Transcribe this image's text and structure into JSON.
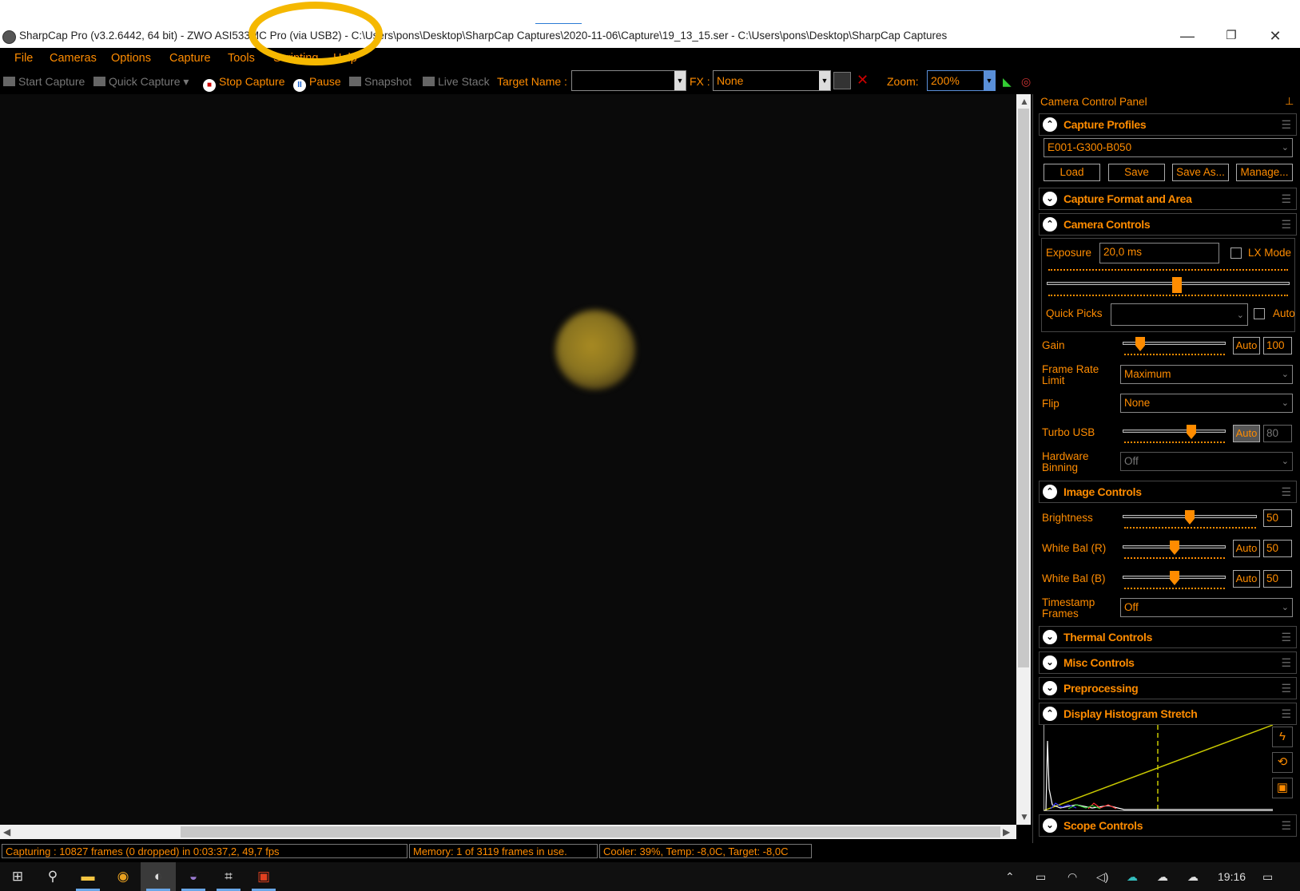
{
  "window": {
    "title": "SharpCap Pro (v3.2.6442, 64 bit) - ZWO ASI533MC Pro (via USB2) - C:\\Users\\pons\\Desktop\\SharpCap Captures\\2020-11-06\\Capture\\19_13_15.ser - C:\\Users\\pons\\Desktop\\SharpCap Captures",
    "minimize": "—",
    "maximize": "❐",
    "close": "✕"
  },
  "menu": [
    "File",
    "Cameras",
    "Options",
    "Capture",
    "Tools",
    "Scripting",
    "Help"
  ],
  "toolbar": {
    "start_capture": "Start Capture",
    "quick_capture": "Quick Capture",
    "stop_capture": "Stop Capture",
    "pause": "Pause",
    "snapshot": "Snapshot",
    "live_stack": "Live Stack",
    "target_name_label": "Target Name :",
    "target_name_value": "",
    "fx_label": "FX :",
    "fx_value": "None",
    "zoom_label": "Zoom:",
    "zoom_value": "200%"
  },
  "status": {
    "capturing": "Capturing : 10827 frames (0 dropped) in 0:03:37,2, 49,7 fps",
    "memory": "Memory: 1 of 3119 frames in use.",
    "cooler": "Cooler: 39%, Temp: -8,0C, Target: -8,0C"
  },
  "panel": {
    "title": "Camera Control Panel",
    "capture_profiles": {
      "title": "Capture Profiles",
      "selected": "E001-G300-B050",
      "buttons": [
        "Load",
        "Save",
        "Save As...",
        "Manage..."
      ]
    },
    "capture_format": {
      "title": "Capture Format and Area"
    },
    "camera_controls": {
      "title": "Camera Controls",
      "exposure_label": "Exposure",
      "exposure_value": "20,0 ms",
      "exposure_slider_fraction": 0.53,
      "lx_mode": "LX Mode",
      "quick_picks_label": "Quick Picks",
      "quick_picks_auto": "Auto",
      "gain_label": "Gain",
      "gain_auto": "Auto",
      "gain_value": "100",
      "gain_slider_fraction": 0.17,
      "frame_rate_label_1": "Frame Rate",
      "frame_rate_label_2": "Limit",
      "frame_rate_value": "Maximum",
      "flip_label": "Flip",
      "flip_value": "None",
      "turbo_label": "Turbo USB",
      "turbo_auto": "Auto",
      "turbo_value": "80",
      "turbo_slider_fraction": 0.67,
      "binning_label_1": "Hardware",
      "binning_label_2": "Binning",
      "binning_value": "Off"
    },
    "image_controls": {
      "title": "Image Controls",
      "brightness_label": "Brightness",
      "brightness_value": "50",
      "brightness_slider_fraction": 0.5,
      "wb_r_label": "White Bal (R)",
      "wb_r_auto": "Auto",
      "wb_r_value": "50",
      "wb_r_slider_fraction": 0.5,
      "wb_b_label": "White Bal (B)",
      "wb_b_auto": "Auto",
      "wb_b_value": "50",
      "wb_b_slider_fraction": 0.5,
      "timestamp_label_1": "Timestamp",
      "timestamp_label_2": "Frames",
      "timestamp_value": "Off"
    },
    "sections_collapsed": [
      "Thermal Controls",
      "Misc Controls",
      "Preprocessing"
    ],
    "histogram": {
      "title": "Display Histogram Stretch"
    },
    "scope": {
      "title": "Scope Controls"
    }
  },
  "taskbar": {
    "clock": "19:16"
  },
  "colors": {
    "accent": "#ff8c00",
    "background": "#000000",
    "highlight_circle": "#f5b800"
  }
}
